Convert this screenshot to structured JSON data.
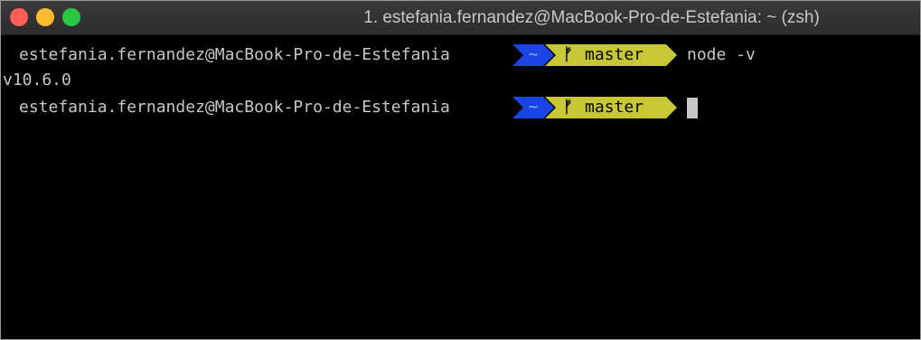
{
  "window": {
    "title": "1. estefania.fernandez@MacBook-Pro-de-Estefania: ~ (zsh)"
  },
  "terminal": {
    "prompt_host": "estefania.fernandez@MacBook-Pro-de-Estefania",
    "dir": "~",
    "branch_icon": "git-branch-icon",
    "branch_glyph": "ᚠ",
    "branch": "master",
    "command_1": "node -v",
    "output_1": "v10.6.0",
    "command_2": ""
  },
  "colors": {
    "dir_segment": "#1a46e6",
    "git_segment": "#c8c836",
    "background": "#000000",
    "text": "#c7c7c7"
  }
}
